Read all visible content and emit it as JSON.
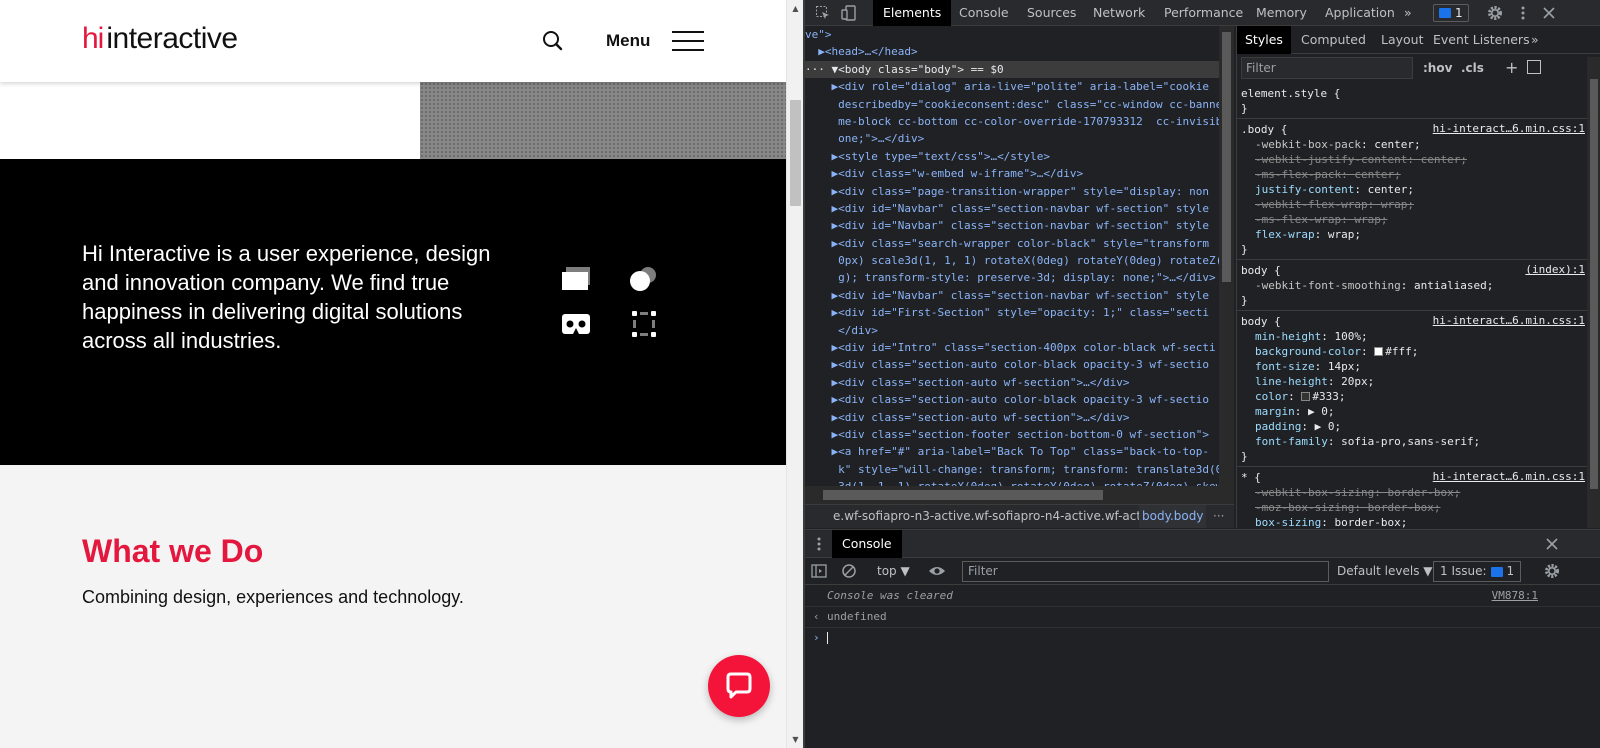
{
  "site": {
    "logo_hi": "hi",
    "logo_text": "interactive",
    "menu_label": "Menu",
    "intro_text": "Hi Interactive is a user experience, design and innovation company. We find true happiness in delivering digital solutions across all industries.",
    "what_title": "What we Do",
    "what_subtitle": "Combining design, experiences and technology.",
    "brand_color": "#e4173e"
  },
  "devtools": {
    "tabs": [
      "Elements",
      "Console",
      "Sources",
      "Network",
      "Performance",
      "Memory",
      "Application"
    ],
    "active_tab": "Elements",
    "more_tabs": "»",
    "issue_count": "1",
    "elements_lines": [
      {
        "indent": "",
        "text": "ve\">"
      },
      {
        "indent": "  ",
        "text": "▶<head>…</head>"
      },
      {
        "indent": "",
        "text": "··· ▼<body class=\"body\"> == $0",
        "sel": true
      },
      {
        "indent": "    ",
        "text": "▶<div role=\"dialog\" aria-live=\"polite\" aria-label=\"cookie"
      },
      {
        "indent": "     ",
        "text": "describedby=\"cookieconsent:desc\" class=\"cc-window cc-banne"
      },
      {
        "indent": "     ",
        "text": "me-block cc-bottom cc-color-override-170793312  cc-invisib"
      },
      {
        "indent": "     ",
        "text": "one;\">…</div>"
      },
      {
        "indent": "    ",
        "text": "▶<style type=\"text/css\">…</style>"
      },
      {
        "indent": "    ",
        "text": "▶<div class=\"w-embed w-iframe\">…</div>"
      },
      {
        "indent": "    ",
        "text": "▶<div class=\"page-transition-wrapper\" style=\"display: non"
      },
      {
        "indent": "    ",
        "text": "▶<div id=\"Navbar\" class=\"section-navbar wf-section\" style"
      },
      {
        "indent": "    ",
        "text": "▶<div id=\"Navbar\" class=\"section-navbar wf-section\" style"
      },
      {
        "indent": "    ",
        "text": "▶<div class=\"search-wrapper color-black\" style=\"transform"
      },
      {
        "indent": "     ",
        "text": "0px) scale3d(1, 1, 1) rotateX(0deg) rotateY(0deg) rotateZ("
      },
      {
        "indent": "     ",
        "text": "g); transform-style: preserve-3d; display: none;\">…</div>"
      },
      {
        "indent": "    ",
        "text": "▶<div id=\"Navbar\" class=\"section-navbar wf-section\" style"
      },
      {
        "indent": "    ",
        "text": "▶<div id=\"First-Section\" style=\"opacity: 1;\" class=\"secti"
      },
      {
        "indent": "     ",
        "text": "</div>"
      },
      {
        "indent": "    ",
        "text": "▶<div id=\"Intro\" class=\"section-400px color-black wf-secti"
      },
      {
        "indent": "    ",
        "text": "▶<div class=\"section-auto color-black opacity-3 wf-sectio"
      },
      {
        "indent": "    ",
        "text": "▶<div class=\"section-auto wf-section\">…</div>"
      },
      {
        "indent": "    ",
        "text": "▶<div class=\"section-auto color-black opacity-3 wf-sectio"
      },
      {
        "indent": "    ",
        "text": "▶<div class=\"section-auto wf-section\">…</div>"
      },
      {
        "indent": "    ",
        "text": "▶<div class=\"section-footer section-bottom-0 wf-section\">"
      },
      {
        "indent": "    ",
        "text": "▶<a href=\"#\" aria-label=\"Back To Top\" class=\"back-to-top-"
      },
      {
        "indent": "     ",
        "text": "k\" style=\"will-change: transform; transform: translate3d(0"
      },
      {
        "indent": "     ",
        "text": "3d(1, 1, 1) rotateX(0deg) rotateY(0deg) rotateZ(0deg) skew"
      }
    ],
    "breadcrumb_left": "e.wf-sofiapro-n3-active.wf-sofiapro-n4-active.wf-active",
    "breadcrumb_right": "body.body",
    "breadcrumb_more": "···",
    "styles_tabs": [
      "Styles",
      "Computed",
      "Layout",
      "Event Listeners",
      "»"
    ],
    "styles_filter_placeholder": "Filter",
    "styles_hov": ":hov",
    "styles_cls": ".cls",
    "rules": [
      {
        "selector": "element.style {",
        "source": "",
        "props": [],
        "close": "}"
      },
      {
        "selector": ".body {",
        "source": "hi-interact…6.min.css:1",
        "props": [
          {
            "name": "-webkit-box-pack",
            "value": "center;",
            "strike": false,
            "gray": true
          },
          {
            "name": "-webkit-justify-content",
            "value": "center;",
            "strike": true
          },
          {
            "name": "-ms-flex-pack",
            "value": "center;",
            "strike": true
          },
          {
            "name": "justify-content",
            "value": "center;",
            "strike": false
          },
          {
            "name": "-webkit-flex-wrap",
            "value": "wrap;",
            "strike": true
          },
          {
            "name": "-ms-flex-wrap",
            "value": "wrap;",
            "strike": true
          },
          {
            "name": "flex-wrap",
            "value": "wrap;",
            "strike": false
          }
        ],
        "close": "}"
      },
      {
        "selector": "body {",
        "source": "(index):1",
        "props": [
          {
            "name": "-webkit-font-smoothing",
            "value": "antialiased;",
            "strike": false,
            "gray": true
          }
        ],
        "close": "}"
      },
      {
        "selector": "body {",
        "source": "hi-interact…6.min.css:1",
        "props": [
          {
            "name": "min-height",
            "value": "100%;",
            "strike": false
          },
          {
            "name": "background-color",
            "value": "#fff;",
            "strike": false,
            "swatch": "#ffffff"
          },
          {
            "name": "font-size",
            "value": "14px;",
            "strike": false
          },
          {
            "name": "line-height",
            "value": "20px;",
            "strike": false
          },
          {
            "name": "color",
            "value": "#333;",
            "strike": false,
            "swatch": "#333333"
          },
          {
            "name": "margin",
            "value": "▶ 0;",
            "strike": false
          },
          {
            "name": "padding",
            "value": "▶ 0;",
            "strike": false
          },
          {
            "name": "font-family",
            "value": "sofia-pro,sans-serif;",
            "strike": false
          }
        ],
        "close": "}"
      },
      {
        "selector": "* {",
        "source": "hi-interact…6.min.css:1",
        "props": [
          {
            "name": "-webkit-box-sizing",
            "value": "border-box;",
            "strike": true
          },
          {
            "name": "-moz-box-sizing",
            "value": "border-box;",
            "strike": true
          },
          {
            "name": "box-sizing",
            "value": "border-box;",
            "strike": false
          }
        ],
        "close": ""
      }
    ],
    "console": {
      "tab_label": "Console",
      "context": "top ▼",
      "filter_placeholder": "Filter",
      "levels": "Default levels ▼",
      "issue_text": "1 Issue:",
      "issue_count": "1",
      "lines": [
        {
          "prefix": "",
          "text": "Console was cleared",
          "source": "VM878:1"
        },
        {
          "prefix": "‹",
          "text": "undefined",
          "source": ""
        }
      ],
      "prompt": "›"
    }
  }
}
